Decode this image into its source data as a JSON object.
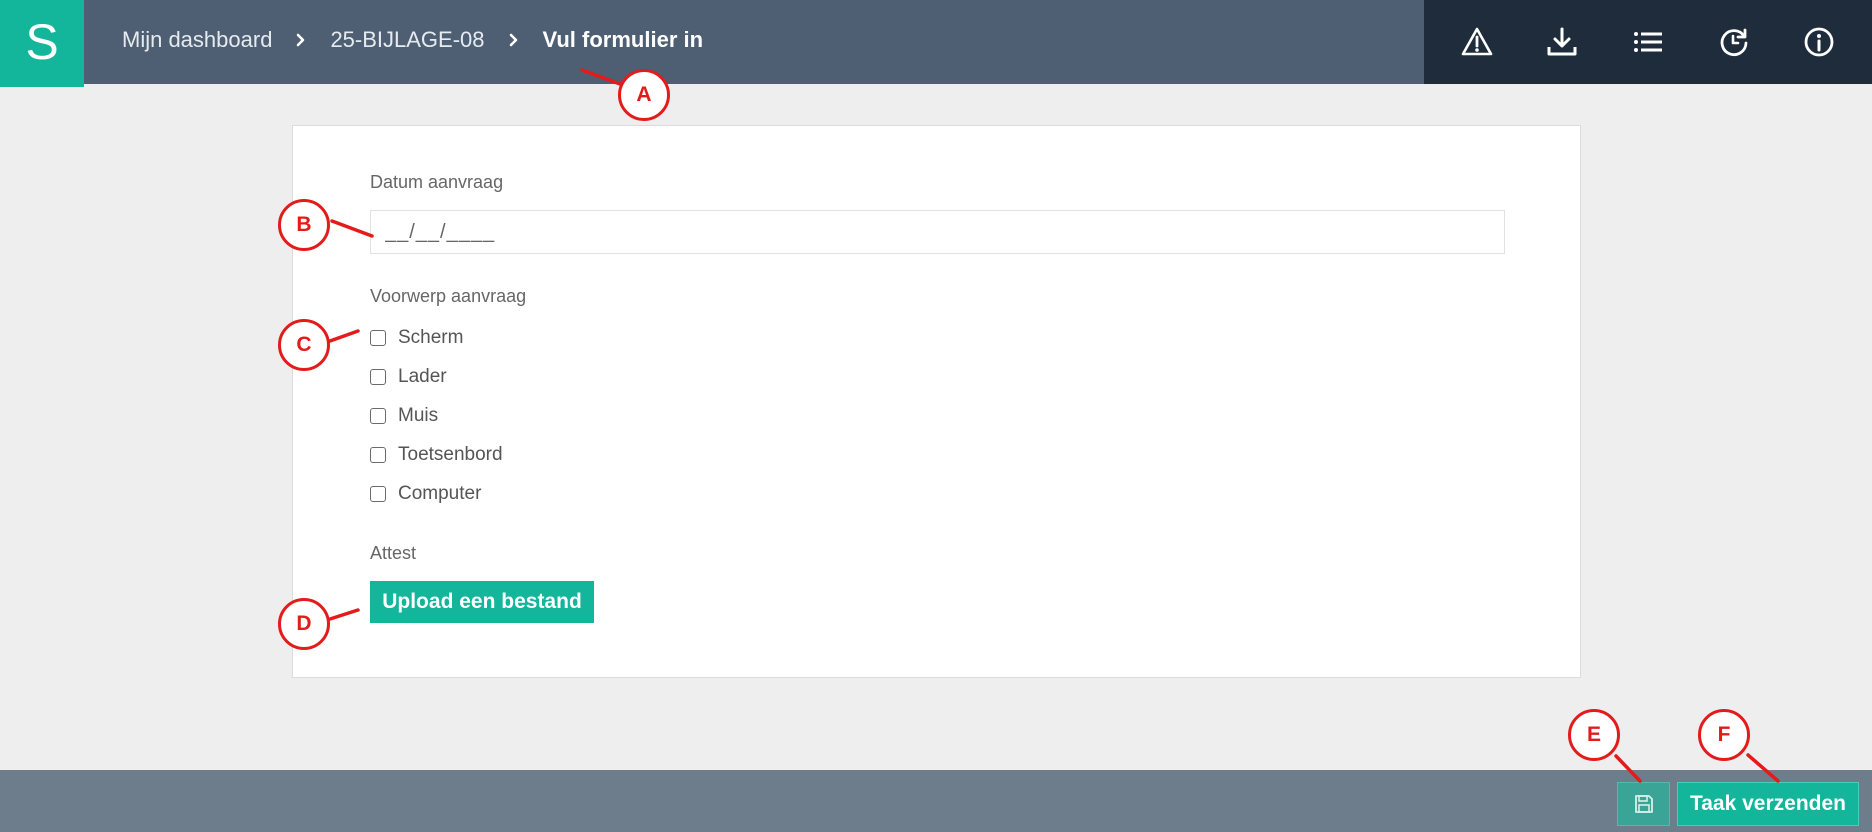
{
  "header": {
    "logo_letter": "S",
    "breadcrumb": [
      {
        "label": "Mijn dashboard"
      },
      {
        "label": "25-BIJLAGE-08"
      },
      {
        "label": "Vul formulier in"
      }
    ],
    "toolbar_icons": [
      "warning-icon",
      "download-icon",
      "list-icon",
      "history-icon",
      "info-icon"
    ]
  },
  "form": {
    "date_label": "Datum aanvraag",
    "date_placeholder": "__/__/____",
    "subject_label": "Voorwerp aanvraag",
    "options": [
      {
        "label": "Scherm",
        "checked": false
      },
      {
        "label": "Lader",
        "checked": false
      },
      {
        "label": "Muis",
        "checked": false
      },
      {
        "label": "Toetsenbord",
        "checked": false
      },
      {
        "label": "Computer",
        "checked": false
      }
    ],
    "attest_label": "Attest",
    "upload_label": "Upload een bestand"
  },
  "footer": {
    "save_icon": "save-icon",
    "send_label": "Taak verzenden"
  },
  "callouts": {
    "a": "A",
    "b": "B",
    "c": "C",
    "d": "D",
    "e": "E",
    "f": "F"
  },
  "colors": {
    "accent": "#13b59b",
    "header": "#4e5f73",
    "toolbar": "#1f2c3b",
    "footer": "#6e7d8c",
    "callout": "#e31b1b"
  }
}
